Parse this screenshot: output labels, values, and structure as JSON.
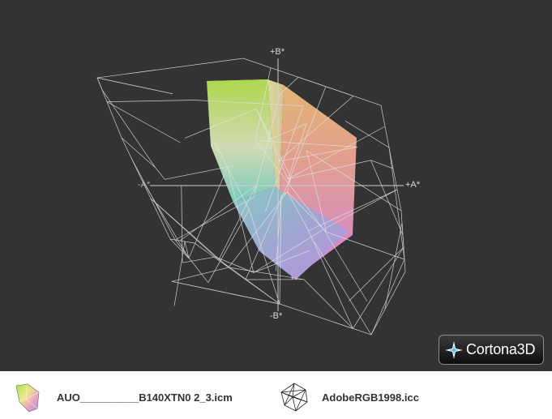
{
  "viewport": {
    "background": "#333333",
    "axes": {
      "b_plus": "+B*",
      "b_minus": "-B*",
      "a_plus": "+A*",
      "a_minus": "-A*"
    },
    "viewer_badge": {
      "brand": "Cortona3D",
      "logo_icon": "cortona-star-icon"
    }
  },
  "legend": {
    "items": [
      {
        "label": "AUO__________B140XTN0 2_3.icm",
        "icon": "colored-gamut-solid-icon"
      },
      {
        "label": "AdobeRGB1998.icc",
        "icon": "wireframe-gamut-icon"
      }
    ]
  }
}
